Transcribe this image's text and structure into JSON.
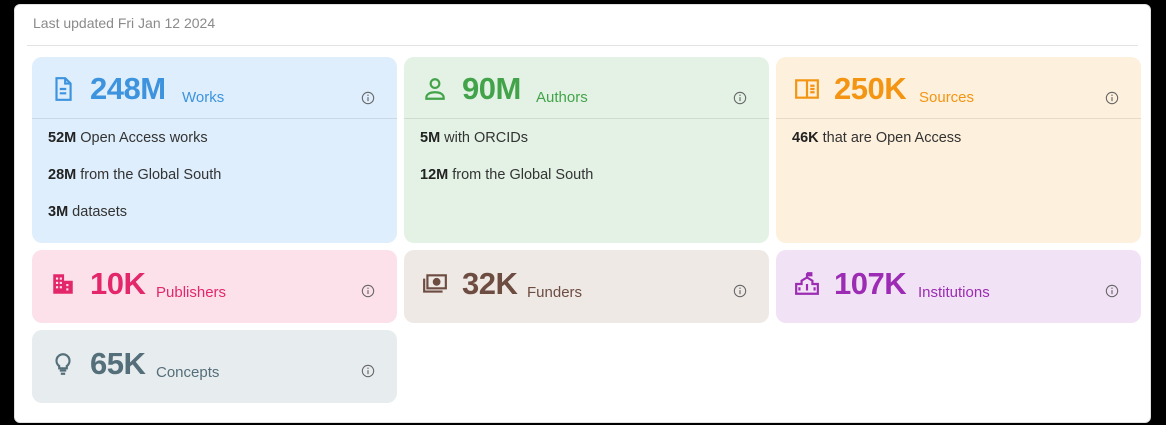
{
  "last_updated": "Last updated Fri Jan 12 2024",
  "colors": {
    "works": "#3d93de",
    "authors": "#43a34a",
    "sources": "#f39512",
    "publishers": "#e3276a",
    "funders": "#6d4c41",
    "institutions": "#9b2cb3",
    "concepts": "#546e7a"
  },
  "cards": {
    "works": {
      "count": "248M",
      "label": "Works",
      "icon": "document-icon",
      "stats": [
        {
          "num": "52M",
          "text": " Open Access works"
        },
        {
          "num": "28M",
          "text": " from the Global South"
        },
        {
          "num": "3M",
          "text": " datasets"
        }
      ]
    },
    "authors": {
      "count": "90M",
      "label": "Authors",
      "icon": "person-icon",
      "stats": [
        {
          "num": "5M",
          "text": " with ORCIDs"
        },
        {
          "num": "12M",
          "text": " from the Global South"
        }
      ]
    },
    "sources": {
      "count": "250K",
      "label": "Sources",
      "icon": "book-open-icon",
      "stats": [
        {
          "num": "46K",
          "text": " that are Open Access"
        }
      ]
    },
    "publishers": {
      "count": "10K",
      "label": "Publishers",
      "icon": "building-icon"
    },
    "funders": {
      "count": "32K",
      "label": "Funders",
      "icon": "money-icon"
    },
    "institutions": {
      "count": "107K",
      "label": "Institutions",
      "icon": "institution-icon"
    },
    "concepts": {
      "count": "65K",
      "label": "Concepts",
      "icon": "lightbulb-icon"
    }
  }
}
